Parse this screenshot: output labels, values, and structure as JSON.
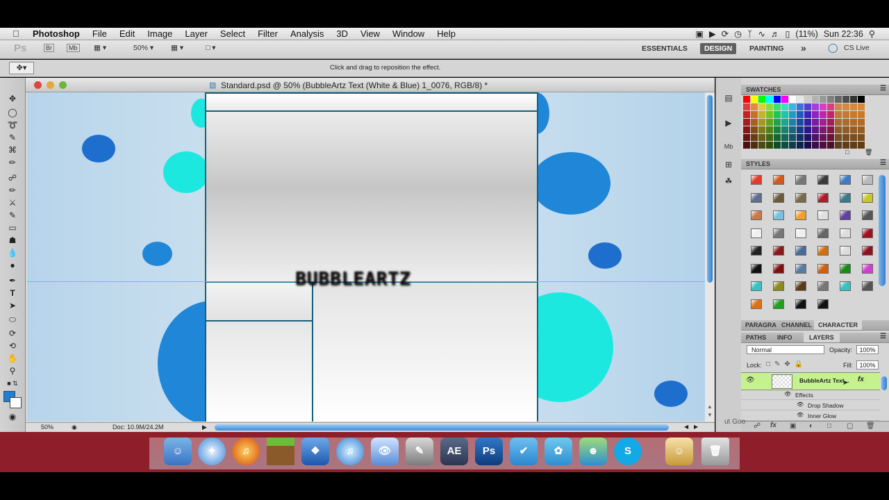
{
  "menubar": {
    "app": "Photoshop",
    "items": [
      "File",
      "Edit",
      "Image",
      "Layer",
      "Select",
      "Filter",
      "Analysis",
      "3D",
      "View",
      "Window",
      "Help"
    ],
    "battery": "(11%)",
    "clock": "Sun 22:36"
  },
  "appbar": {
    "ps_logo": "Ps",
    "br": "Br",
    "mb": "Mb",
    "zoom": "50%",
    "workspaces": [
      "ESSENTIALS",
      "DESIGN",
      "PAINTING"
    ],
    "more": "»",
    "cslive": "CS Live"
  },
  "options": {
    "hint": "Click and drag to reposition the effect."
  },
  "document": {
    "title": "Standard.psd @ 50% (BubbleArtz Text (White & Blue) 1_0076, RGB/8) *",
    "canvas_text": "BUBBLEARTZ",
    "status_zoom": "50%",
    "status_doc": "Doc: 10.9M/24.2M"
  },
  "swatches_tab": "SWATCHES",
  "styles_tab": "STYLES",
  "char_tabs": [
    "PARAGRA",
    "CHANNEL",
    "CHARACTER"
  ],
  "layer_tabs": [
    "PATHS",
    "INFO",
    "LAYERS"
  ],
  "layers": {
    "blend_mode": "Normal",
    "opacity_label": "Opacity:",
    "opacity": "100%",
    "lock_label": "Lock:",
    "fill_label": "Fill:",
    "fill": "100%",
    "layer_name": "BubbleArtz Text...",
    "fx": "fx",
    "effects": "Effects",
    "effect1": "Drop Shadow",
    "effect2": "Inner Glow"
  },
  "behind_text": "ut Goo",
  "colors": {
    "accent_blue": "#1e7fd4",
    "cyan": "#1de8e0",
    "layer_green": "#c5f28f",
    "dock_red": "#8e1f2a"
  },
  "dock": {
    "ae_label": "AE",
    "ps_label": "Ps"
  }
}
